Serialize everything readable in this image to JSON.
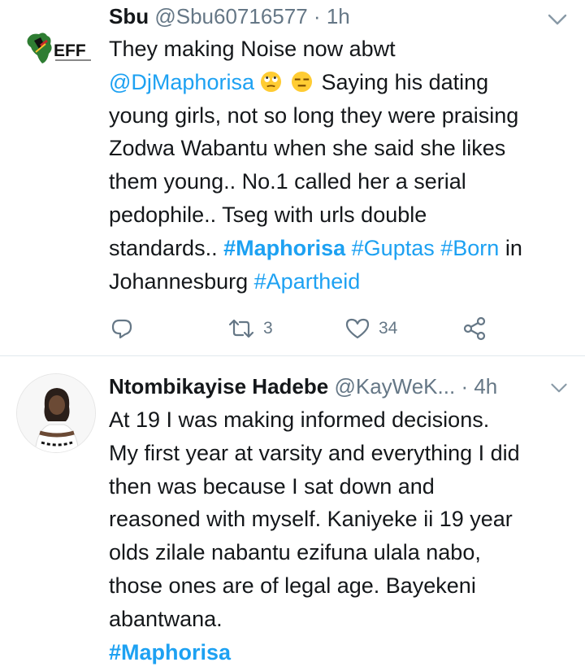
{
  "tweets": [
    {
      "name": "Sbu",
      "handle": "@Sbu60716577",
      "dot": "·",
      "time": "1h",
      "avatar_text": "EFF",
      "text": {
        "line1": "They making Noise now abwt",
        "mention": "@DjMaphorisa",
        "emoji1": "eye-roll-face",
        "emoji2": "expressionless-face",
        "line2_rest": "Saying his dating",
        "line3": "young girls, not so long they were praising",
        "line4": "Zodwa Wabantu when she said she likes",
        "line5": "them young.. No.1 called her a serial",
        "line6": "pedophile.. Tseg with urls double",
        "line7_start": "standards..",
        "tag1": "#Maphorisa",
        "tag2": "#Guptas",
        "tag3": "#Born",
        "line7_end": "in",
        "line8_start": "Johannesburg",
        "tag4": "#Apartheid"
      },
      "actions": {
        "reply_icon": "reply-icon",
        "retweet_count": "3",
        "like_count": "34",
        "share_icon": "share-icon"
      }
    },
    {
      "name": "Ntombikayise Hadebe",
      "handle": "@KayWeK...",
      "dot": "·",
      "time": "4h",
      "text": {
        "line1": "At 19 I was making informed decisions.",
        "line2": "My first year at varsity and everything I did",
        "line3": "then was because I sat down and",
        "line4": "reasoned with myself. Kaniyeke ii 19 year",
        "line5": "olds zilale nabantu ezifuna ulala nabo,",
        "line6": "those ones are of legal age. Bayekeni",
        "line7": "abantwana.",
        "tag": "#Maphorisa"
      }
    }
  ],
  "colors": {
    "link": "#1da1f2",
    "muted": "#657786",
    "text": "#14171a",
    "divider": "#e1e8ed"
  }
}
